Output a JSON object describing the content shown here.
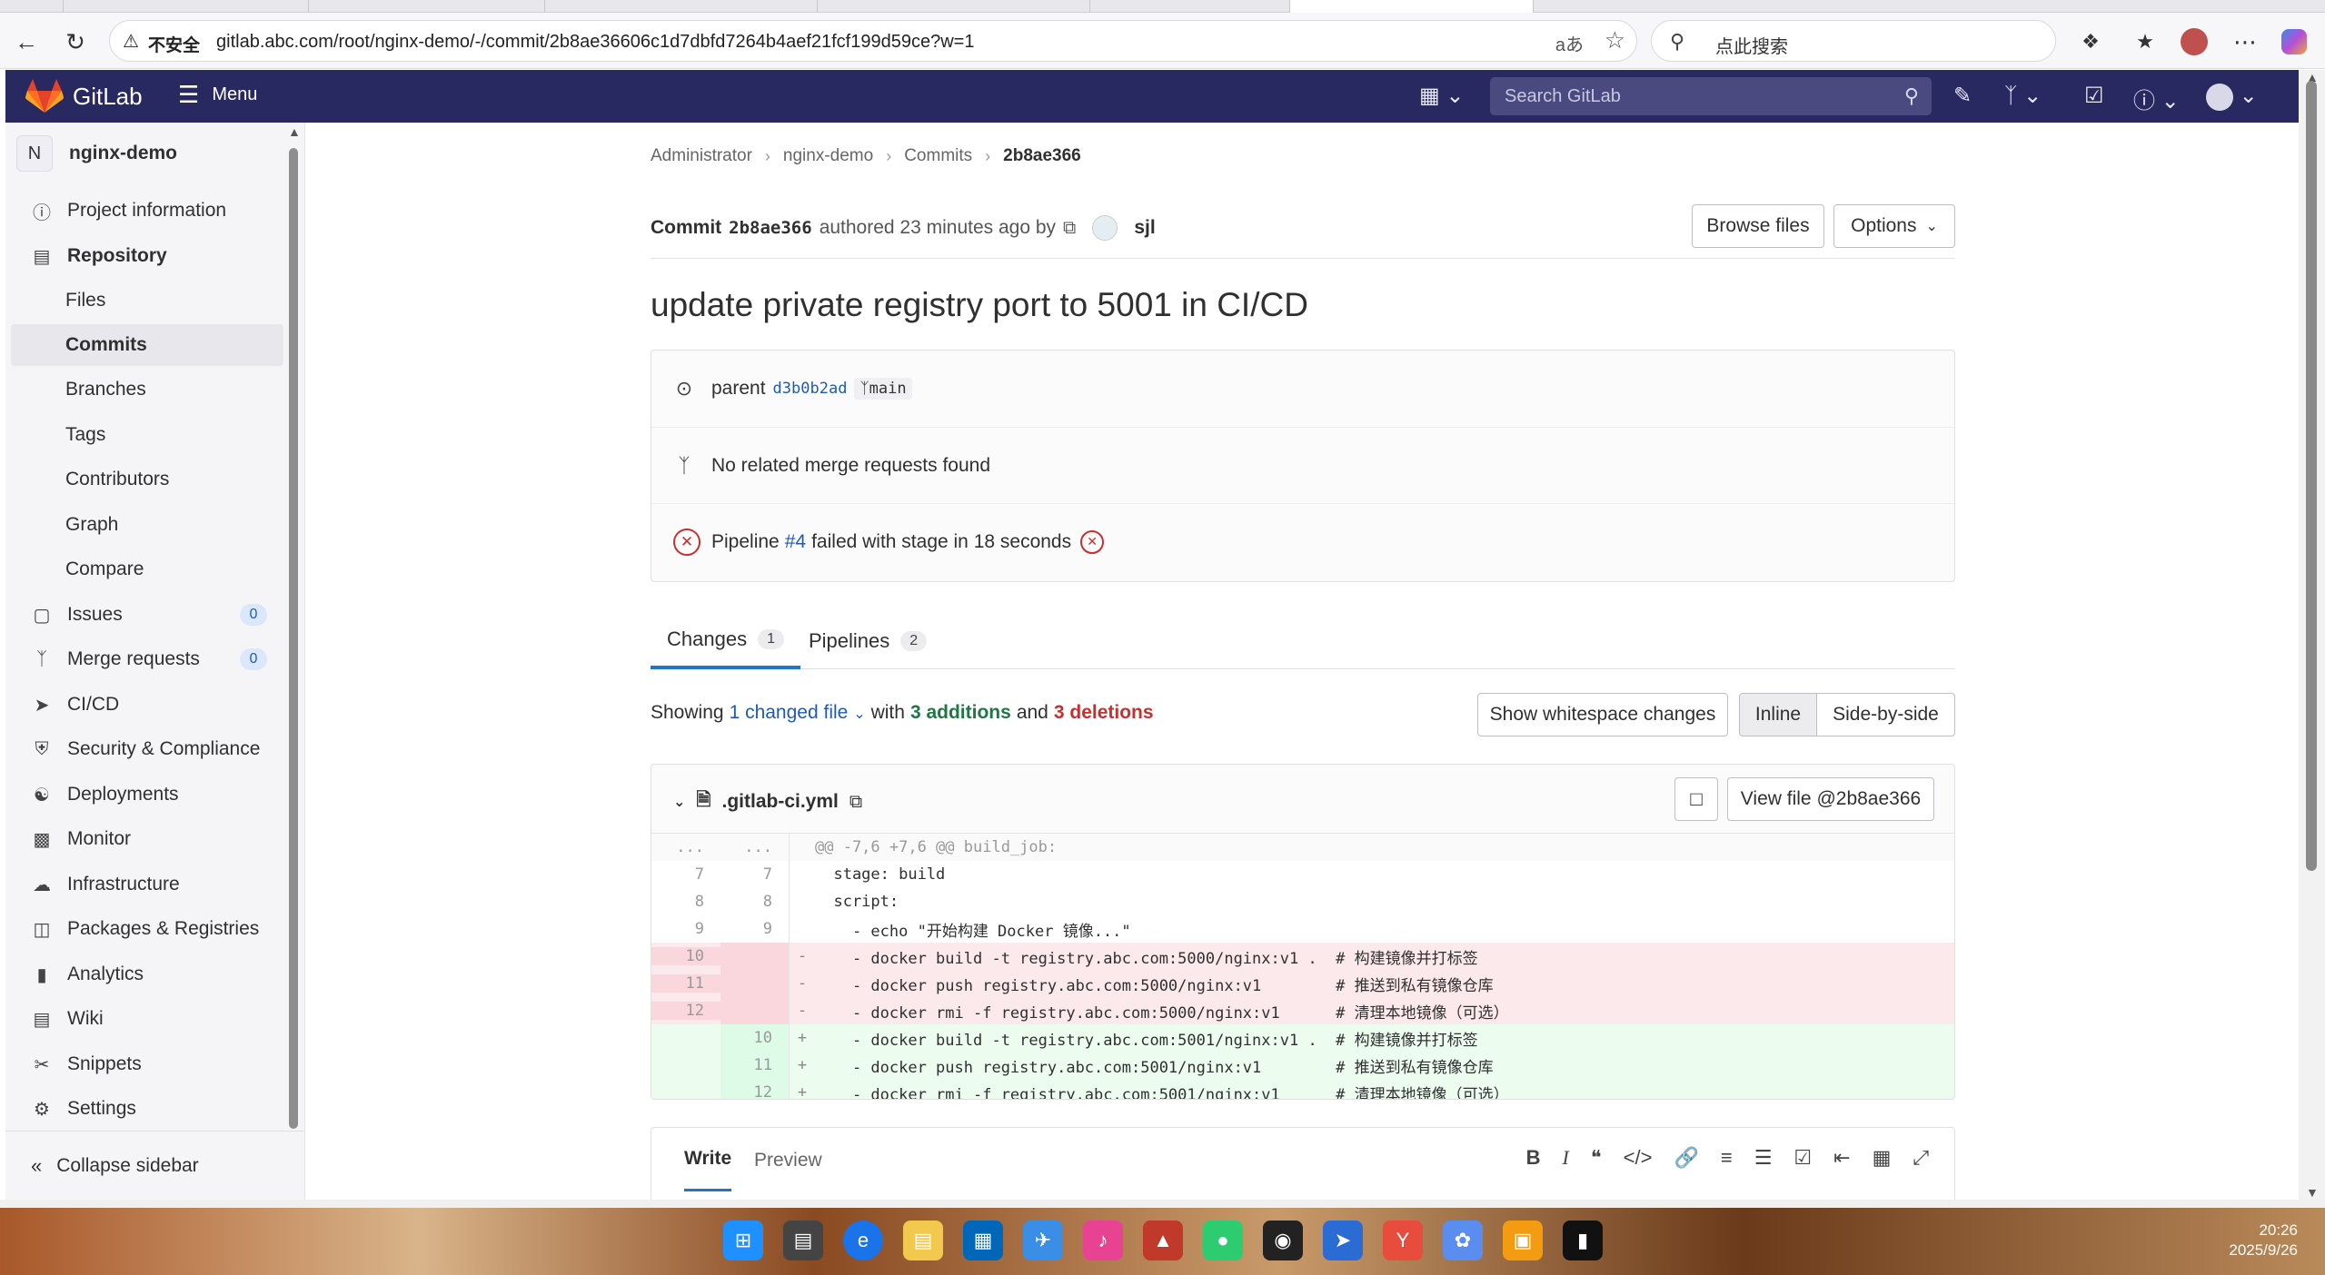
{
  "browser": {
    "insecure_label": "不安全",
    "url": "gitlab.abc.com/root/nginx-demo/-/commit/2b8ae36606c1d7dbfd7264b4aef21fcf199d59ce?w=1",
    "search_placeholder": "点此搜索",
    "read_aloud": "aあ"
  },
  "header": {
    "brand": "GitLab",
    "menu_label": "Menu",
    "search_placeholder": "Search GitLab"
  },
  "sidebar": {
    "project_initial": "N",
    "project_name": "nginx-demo",
    "items": [
      {
        "label": "Project information",
        "icon": "info-icon"
      },
      {
        "label": "Repository",
        "icon": "book-icon"
      },
      {
        "label": "Files"
      },
      {
        "label": "Commits"
      },
      {
        "label": "Branches"
      },
      {
        "label": "Tags"
      },
      {
        "label": "Contributors"
      },
      {
        "label": "Graph"
      },
      {
        "label": "Compare"
      },
      {
        "label": "Issues",
        "icon": "issues-icon",
        "count": "0"
      },
      {
        "label": "Merge requests",
        "icon": "merge-request-icon",
        "count": "0"
      },
      {
        "label": "CI/CD",
        "icon": "rocket-icon"
      },
      {
        "label": "Security & Compliance",
        "icon": "shield-icon"
      },
      {
        "label": "Deployments",
        "icon": "deployments-icon"
      },
      {
        "label": "Monitor",
        "icon": "monitor-icon"
      },
      {
        "label": "Infrastructure",
        "icon": "cloud-icon"
      },
      {
        "label": "Packages & Registries",
        "icon": "package-icon"
      },
      {
        "label": "Analytics",
        "icon": "chart-icon"
      },
      {
        "label": "Wiki",
        "icon": "wiki-icon"
      },
      {
        "label": "Snippets",
        "icon": "snippet-icon"
      },
      {
        "label": "Settings",
        "icon": "settings-icon"
      }
    ],
    "collapse_label": "Collapse sidebar"
  },
  "breadcrumb": [
    "Administrator",
    "nginx-demo",
    "Commits",
    "2b8ae366"
  ],
  "commit": {
    "label": "Commit",
    "sha_short": "2b8ae366",
    "authored": "authored 23 minutes ago by",
    "author": "sjl",
    "browse_files": "Browse files",
    "options": "Options",
    "title": "update private registry port to 5001 in CI/CD",
    "parent_label": "parent",
    "parent_sha": "d3b0b2ad",
    "branch": "main",
    "no_mr": "No related merge requests found",
    "pipeline_prefix": "Pipeline",
    "pipeline_id": "#4",
    "pipeline_suffix": "failed with stage in 18 seconds"
  },
  "tabs": [
    {
      "label": "Changes",
      "count": "1"
    },
    {
      "label": "Pipelines",
      "count": "2"
    }
  ],
  "stats": {
    "showing": "Showing",
    "changed": "1 changed file",
    "with": "with",
    "additions": "3 additions",
    "and": "and",
    "deletions": "3 deletions",
    "whitespace_btn": "Show whitespace changes",
    "inline_btn": "Inline",
    "side_btn": "Side-by-side"
  },
  "file": {
    "name": ".gitlab-ci.yml",
    "view_file": "View file @2b8ae366"
  },
  "diff": [
    {
      "type": "meta",
      "old": "...",
      "new": "...",
      "sign": "",
      "code": "@@ -7,6 +7,6 @@ build_job:"
    },
    {
      "type": "ctx",
      "old": "7",
      "new": "7",
      "sign": "",
      "code": "  stage: build"
    },
    {
      "type": "ctx",
      "old": "8",
      "new": "8",
      "sign": "",
      "code": "  script:"
    },
    {
      "type": "ctx",
      "old": "9",
      "new": "9",
      "sign": "",
      "code": "    - echo \"开始构建 Docker 镜像...\""
    },
    {
      "type": "old",
      "old": "10",
      "new": "",
      "sign": "-",
      "code": "    - docker build -t registry.abc.com:5000/nginx:v1 .  # 构建镜像并打标签"
    },
    {
      "type": "old",
      "old": "11",
      "new": "",
      "sign": "-",
      "code": "    - docker push registry.abc.com:5000/nginx:v1        # 推送到私有镜像仓库"
    },
    {
      "type": "old",
      "old": "12",
      "new": "",
      "sign": "-",
      "code": "    - docker rmi -f registry.abc.com:5000/nginx:v1      # 清理本地镜像（可选）"
    },
    {
      "type": "new",
      "old": "",
      "new": "10",
      "sign": "+",
      "code": "    - docker build -t registry.abc.com:5001/nginx:v1 .  # 构建镜像并打标签"
    },
    {
      "type": "new",
      "old": "",
      "new": "11",
      "sign": "+",
      "code": "    - docker push registry.abc.com:5001/nginx:v1        # 推送到私有镜像仓库"
    },
    {
      "type": "new",
      "old": "",
      "new": "12",
      "sign": "+",
      "code": "    - docker rmi -f registry.abc.com:5001/nginx:v1      # 清理本地镜像（可选）"
    }
  ],
  "editor": {
    "write": "Write",
    "preview": "Preview"
  },
  "taskbar": {
    "time": "20:26",
    "date": "2025/9/26"
  },
  "colors": {
    "header_bg": "#292961",
    "accent": "#1f75cb",
    "addition": "#217645",
    "deletion": "#c53030"
  }
}
